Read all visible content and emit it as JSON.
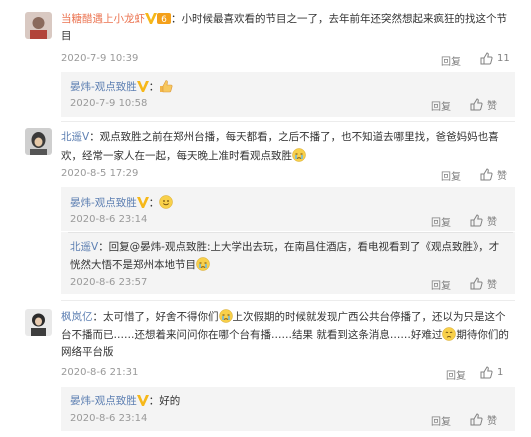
{
  "comments": [
    {
      "user": "当糖醋遇上小龙虾",
      "text_line1": "：小时候最喜欢看的节目之一了，去年前年还突然想起来疯狂的找这个节",
      "text_line2": "目",
      "date": "2020-7-9 10:39",
      "reply_label": "回复",
      "like_count": "11"
    },
    {
      "user": "北遥V",
      "text_line1": "：观点致胜之前在郑州台播，每天都看，之后不播了，也不知道去哪里找，爸爸妈妈也喜",
      "text_line2": "欢，经常一家人在一起，每天晚上准时看观点致胜",
      "date": "2020-8-5 17:29",
      "reply_label": "回复",
      "like_label": "赞"
    },
    {
      "user": "枫岚亿",
      "text_line1a": "：太可惜了，好舍不得你们",
      "text_line1b": "上次假期的时候就发现广西公共台停播了，还以为只是这个",
      "text_line2": "台不播而已……还想着来问问你在哪个台有播……结果 就看到这条消息……好难过",
      "text_line2b": "期待你们的",
      "text_line3": "网络平台版",
      "date": "2020-8-6 21:31",
      "reply_label": "回复",
      "like_count": "1"
    }
  ],
  "replies": [
    {
      "user": "晏炜-观点致胜",
      "suffix": "：",
      "date": "2020-7-9 10:58",
      "reply_label": "回复",
      "like_label": "赞"
    },
    {
      "user": "晏炜-观点致胜",
      "suffix": "：",
      "date": "2020-8-6 23:14",
      "reply_label": "回复",
      "like_label": "赞"
    },
    {
      "user": "北遥V",
      "text_line1": "：回复@晏炜-观点致胜:上大学出去玩，在南昌住酒店，看电视看到了《观点致胜》，才",
      "text_line2": "恍然大悟不是郑州本地节目",
      "date": "2020-8-6 23:57",
      "reply_label": "回复",
      "like_label": "赞"
    },
    {
      "user": "晏炜-观点致胜",
      "text": "：好的",
      "date": "2020-8-6 23:14",
      "reply_label": "回复",
      "like_label": "赞"
    }
  ],
  "icons": {
    "verified": "verified-v-badge-icon",
    "like": "thumbs-up-icon",
    "thumb_emoji": "thumbs-up-emoji-icon",
    "cry_emoji": "crying-emoji-icon",
    "smile_emoji": "smile-emoji-icon",
    "sad_emoji": "sad-emoji-icon"
  },
  "colors": {
    "username": "#eb7350",
    "link": "#5d7fb2",
    "reply_bg": "#f4f4f4",
    "verified": "#f6b81a"
  }
}
